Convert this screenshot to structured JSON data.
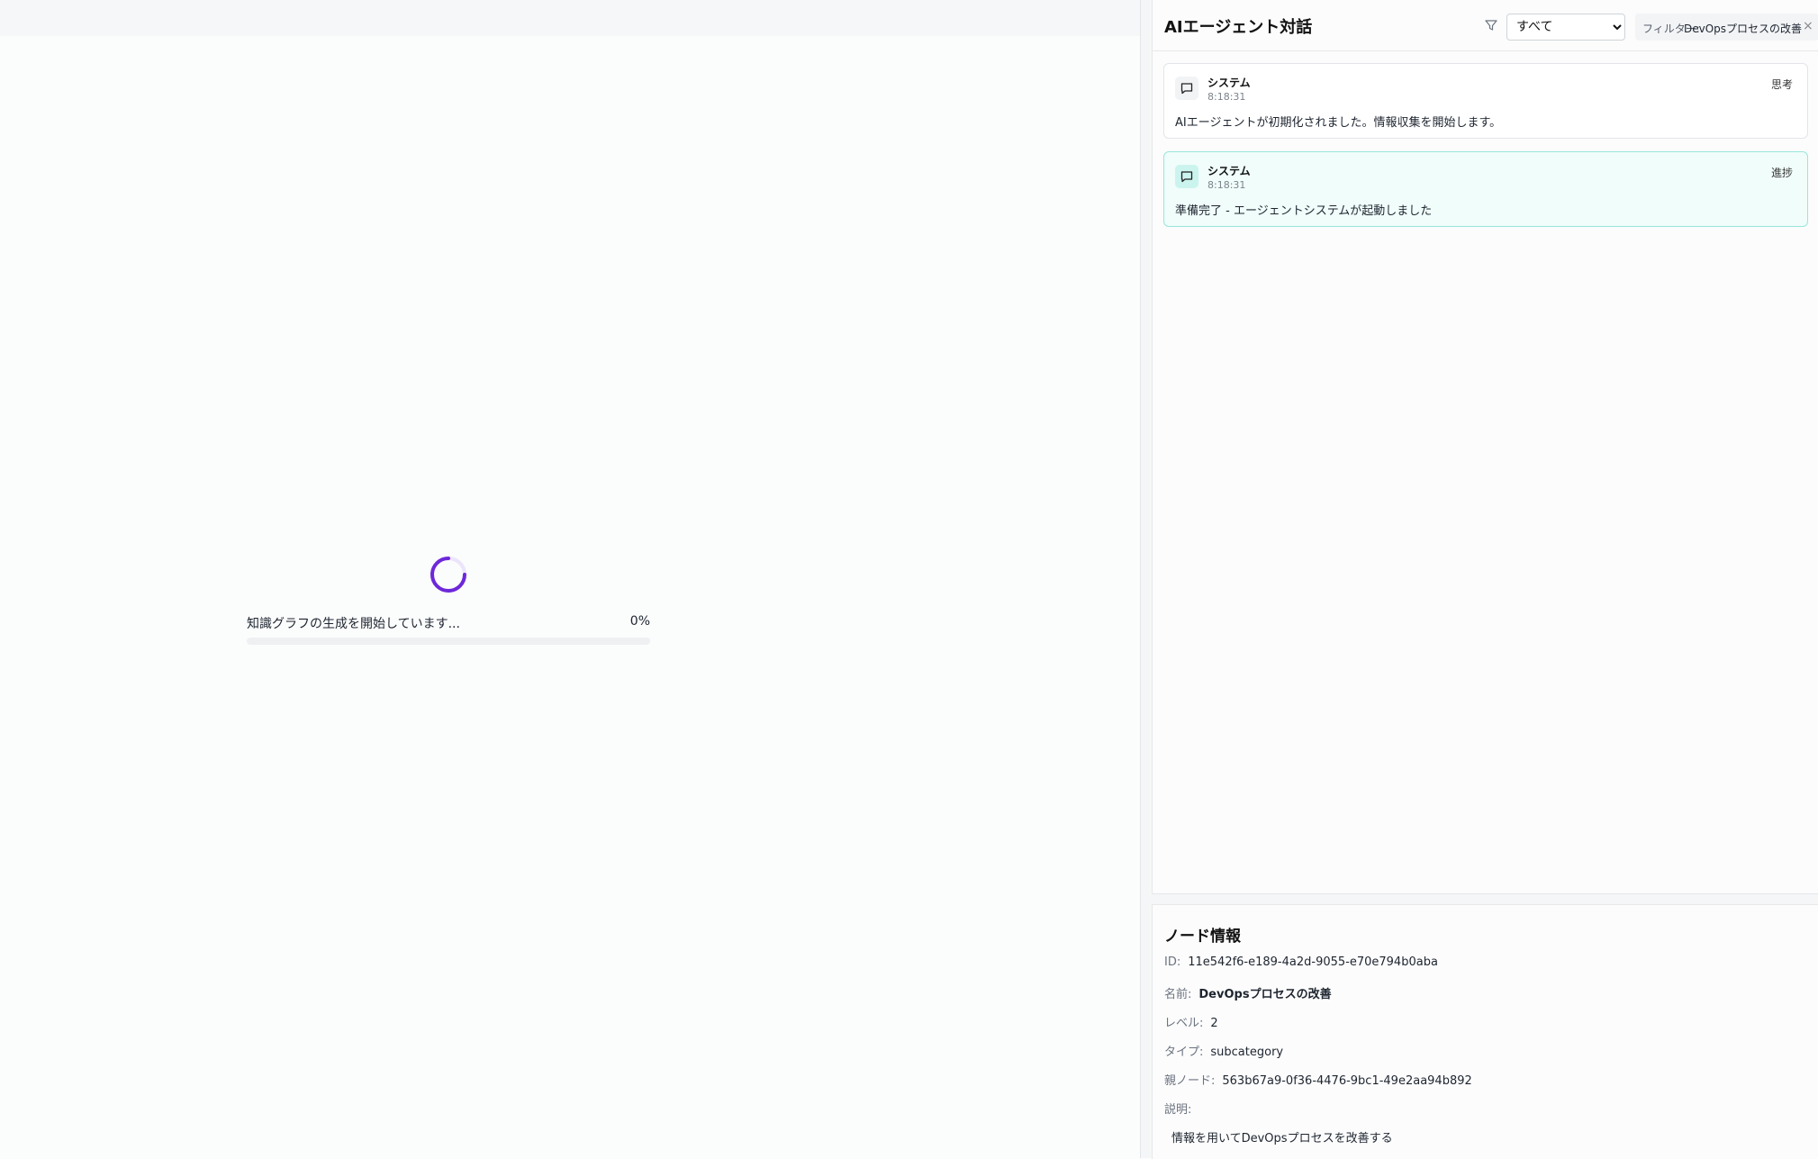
{
  "loader": {
    "message": "知識グラフの生成を開始しています...",
    "percent_label": "0%",
    "progress_fraction": 0,
    "spinner_color": "#6d28d9"
  },
  "chat": {
    "title": "AIエージェント対話",
    "filter_icon": "filter-icon",
    "filter_selected": "すべて",
    "filter_chip_prefix": "フィルター:",
    "filter_chip_value": "DevOpsプロセスの改善",
    "filter_chip_close": "×",
    "messages": [
      {
        "sender": "システム",
        "time": "8:18:31",
        "type": "思考",
        "text": "AIエージェントが初期化されました。情報収集を開始します。",
        "icon": "message-icon"
      },
      {
        "sender": "システム",
        "time": "8:18:31",
        "type": "進捗",
        "text": "準備完了 - エージェントシステムが起動しました",
        "icon": "message-icon",
        "accent": "#99e6dc"
      }
    ]
  },
  "node_info": {
    "title": "ノード情報",
    "fields": [
      {
        "key": "ID:",
        "value": "11e542f6-e189-4a2d-9055-e70e794b0aba"
      },
      {
        "key": "名前:",
        "value": "DevOpsプロセスの改善"
      },
      {
        "key": "レベル:",
        "value": "2"
      },
      {
        "key": "タイプ:",
        "value": "subcategory"
      },
      {
        "key": "親ノード:",
        "value": "563b67a9-0f36-4476-9bc1-49e2aa94b892"
      },
      {
        "key": "説明:",
        "value": ""
      }
    ],
    "description": "情報を用いてDevOpsプロセスを改善する"
  }
}
